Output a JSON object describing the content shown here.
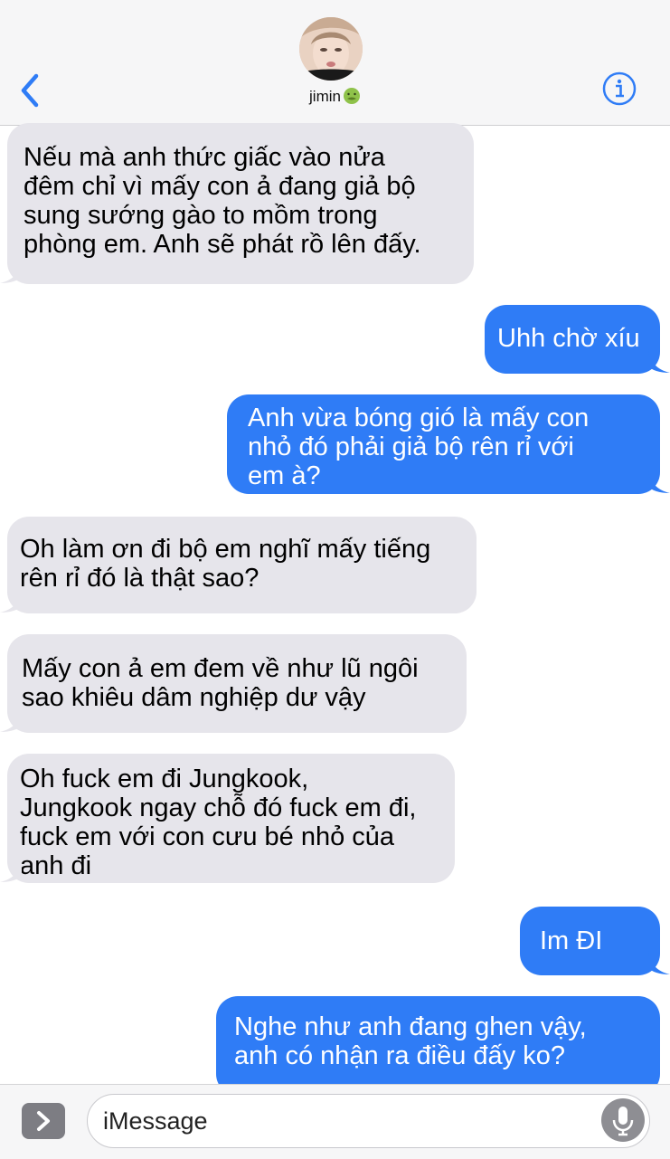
{
  "header": {
    "contact_name": "jimin",
    "back_icon": "chevron-left-icon",
    "info_icon": "info-icon",
    "accent": "#2f7cf6"
  },
  "messages": [
    {
      "direction": "received",
      "text": "Nếu mà anh thức giấc vào nửa\nđêm chỉ vì mấy con ả đang giả bộ\nsung sướng gào to mồm trong\nphòng em. Anh sẽ phát rồ lên đấy."
    },
    {
      "direction": "sent",
      "text": "Uhh chờ xíu"
    },
    {
      "direction": "sent",
      "text": "Anh vừa bóng gió là mấy con\nnhỏ đó phải giả bộ rên rỉ với\nem à?"
    },
    {
      "direction": "received",
      "text": "Oh làm ơn đi bộ em nghĩ mấy tiếng\nrên rỉ đó là thật sao?"
    },
    {
      "direction": "received",
      "text": "Mấy con ả em đem về như lũ ngôi\nsao khiêu dâm nghiệp dư vậy"
    },
    {
      "direction": "received",
      "text": "Oh fuck em đi Jungkook,\nJungkook ngay chỗ đó fuck em đi,\nfuck em với con cưu bé nhỏ của\nanh đi"
    },
    {
      "direction": "sent",
      "text": "Im ĐI"
    },
    {
      "direction": "sent",
      "text": "Nghe như anh đang ghen vậy,\nanh có nhận ra điều đấy ko?"
    }
  ],
  "compose": {
    "placeholder": "iMessage",
    "apps_icon": "chevron-right-icon",
    "mic_icon": "microphone-icon"
  },
  "colors": {
    "received_bubble": "#e6e5eb",
    "sent_bubble": "#2f7cf6"
  }
}
